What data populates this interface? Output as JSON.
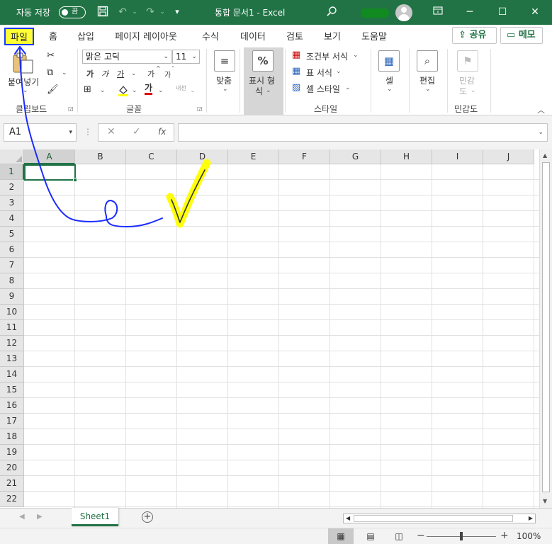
{
  "titlebar": {
    "autosave_label": "자동 저장",
    "autosave_state": "끔",
    "doc_title": "통합 문서1  -  Excel",
    "save_icon": "save-icon",
    "undo_icon": "undo-icon",
    "redo_icon": "redo-icon",
    "customize_icon": "chevron-down-icon",
    "search_icon": "search-icon",
    "window_controls": [
      "ribbon-display-icon",
      "minimize-icon",
      "maximize-icon",
      "close-icon"
    ],
    "colors": {
      "bar": "#217346",
      "blob": "#118a1f"
    }
  },
  "tabs": [
    "파일",
    "홈",
    "삽입",
    "페이지 레이아웃",
    "수식",
    "데이터",
    "검토",
    "보기",
    "도움말"
  ],
  "share_label": "공유",
  "memo_label": "메모",
  "ribbon": {
    "clipboard": {
      "paste_label": "붙여넣기",
      "group_label": "클립보드"
    },
    "font": {
      "font_name": "맑은 고딕",
      "font_size": "11",
      "bold": "가",
      "italic": "가",
      "underline": "가",
      "grow": "가",
      "shrink": "가",
      "font_color": "가",
      "phonetic": "내천",
      "group_label": "글꼴"
    },
    "alignment": {
      "label": "맞춤"
    },
    "number": {
      "label_1": "표시 형",
      "label_2": "식"
    },
    "styles": {
      "conditional": "조건부 서식",
      "table": "표 서식",
      "cell_style": "셀 스타일",
      "group_label": "스타일"
    },
    "cells": {
      "label": "셀"
    },
    "editing": {
      "label": "편집"
    },
    "sensitivity": {
      "label_1": "민감",
      "label_2": "도",
      "group_label": "민감도"
    }
  },
  "formula_bar": {
    "name_box": "A1",
    "fx_label": "fx",
    "formula_value": ""
  },
  "grid": {
    "columns": [
      "A",
      "B",
      "C",
      "D",
      "E",
      "F",
      "G",
      "H",
      "I",
      "J"
    ],
    "rows": [
      "1",
      "2",
      "3",
      "4",
      "5",
      "6",
      "7",
      "8",
      "9",
      "10",
      "11",
      "12",
      "13",
      "14",
      "15",
      "16",
      "17",
      "18",
      "19",
      "20",
      "21",
      "22"
    ],
    "selected_cell": "A1"
  },
  "sheets": [
    "Sheet1"
  ],
  "status": {
    "zoom": "100%",
    "zoom_minus": "−",
    "zoom_plus": "+"
  },
  "annotations": {
    "pen_blue": "#1a2bff",
    "highlighter_yellow": "#ffff00"
  }
}
